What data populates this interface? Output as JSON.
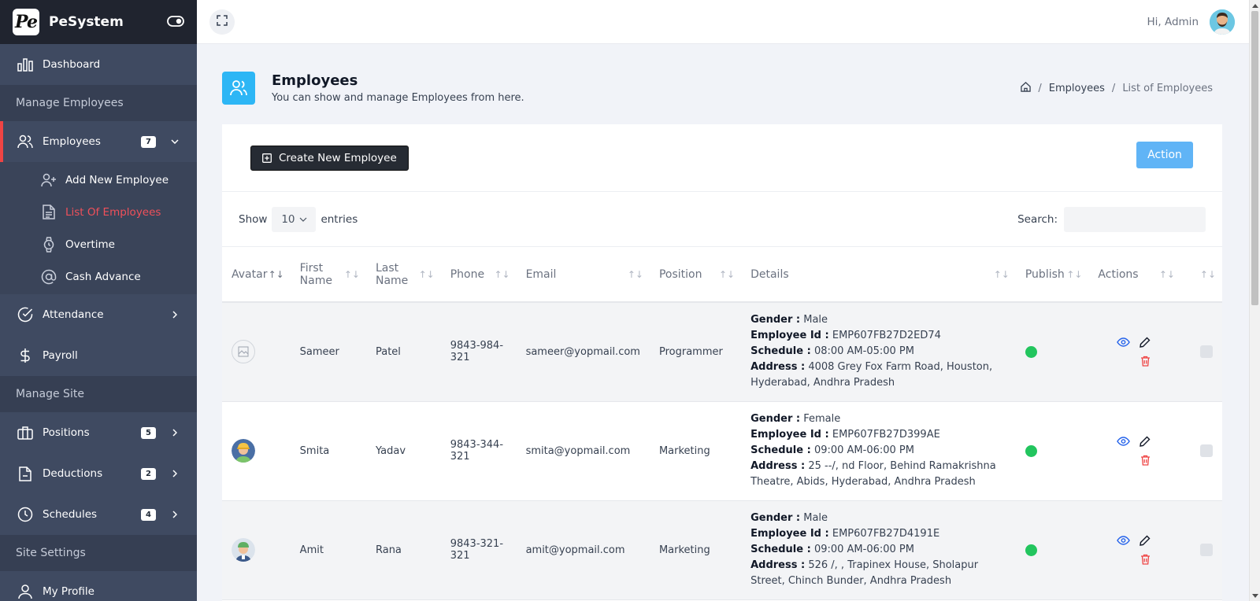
{
  "app": {
    "brand_mark": "Pe",
    "brand_name": "PeSystem"
  },
  "sidebar": {
    "dashboard": "Dashboard",
    "section_manage_employees": "Manage Employees",
    "employees": {
      "label": "Employees",
      "badge": "7"
    },
    "sub_items": [
      "Add New Employee",
      "List Of Employees",
      "Overtime",
      "Cash Advance"
    ],
    "attendance": "Attendance",
    "payroll": "Payroll",
    "section_manage_site": "Manage Site",
    "positions": {
      "label": "Positions",
      "badge": "5"
    },
    "deductions": {
      "label": "Deductions",
      "badge": "2"
    },
    "schedules": {
      "label": "Schedules",
      "badge": "4"
    },
    "section_site_settings": "Site Settings",
    "my_profile": "My Profile"
  },
  "topbar": {
    "greeting": "Hi, Admin"
  },
  "page": {
    "title": "Employees",
    "subtitle": "You can show and manage Employees from here.",
    "breadcrumb": [
      "Employees",
      "List of Employees"
    ]
  },
  "toolbar": {
    "create_label": "Create New Employee",
    "action_label": "Action"
  },
  "table_controls": {
    "show": "Show",
    "entries_value": "10",
    "entries": "entries",
    "search": "Search:"
  },
  "table": {
    "headers": [
      "Avatar",
      "First Name",
      "Last Name",
      "Phone",
      "Email",
      "Position",
      "Details",
      "Publish",
      "Actions"
    ],
    "detail_labels": {
      "gender": "Gender :",
      "employee_id": "Employee Id :",
      "schedule": "Schedule :",
      "address": "Address :"
    },
    "rows": [
      {
        "first": "Sameer",
        "last": "Patel",
        "phone": "9843-984-321",
        "email": "sameer@yopmail.com",
        "position": "Programmer",
        "gender": "Male",
        "employee_id": "EMP607FB27D2ED74",
        "schedule": "08:00 AM-05:00 PM",
        "address": "4008 Grey Fox Farm Road, Houston, Hyderabad, Andhra Pradesh"
      },
      {
        "first": "Smita",
        "last": "Yadav",
        "phone": "9843-344-321",
        "email": "smita@yopmail.com",
        "position": "Marketing",
        "gender": "Female",
        "employee_id": "EMP607FB27D399AE",
        "schedule": "09:00 AM-06:00 PM",
        "address": "25 --/, nd Floor, Behind Ramakrishna Theatre, Abids, Hyderabad, Andhra Pradesh"
      },
      {
        "first": "Amit",
        "last": "Rana",
        "phone": "9843-321-321",
        "email": "amit@yopmail.com",
        "position": "Marketing",
        "gender": "Male",
        "employee_id": "EMP607FB27D4191E",
        "schedule": "09:00 AM-06:00 PM",
        "address": "526 /, , Trapinex House, Sholapur Street, Chinch Bunder, Andhra Pradesh"
      }
    ]
  },
  "colors": {
    "sidebar": "#3f4a61",
    "brand_bar": "#20242f",
    "accent_red": "#ef4444",
    "primary_blue": "#60b4f6",
    "publish_green": "#22c55e"
  },
  "icons": [
    "toggle-icon",
    "bar-chart-icon",
    "users-icon",
    "user-plus-icon",
    "file-list-icon",
    "watch-icon",
    "at-sign-icon",
    "check-circle-icon",
    "dollar-icon",
    "briefcase-icon",
    "file-minus-icon",
    "clock-icon",
    "user-icon",
    "expand-icon",
    "home-icon",
    "plus-square-icon",
    "eye-icon",
    "edit-icon",
    "trash-icon"
  ]
}
